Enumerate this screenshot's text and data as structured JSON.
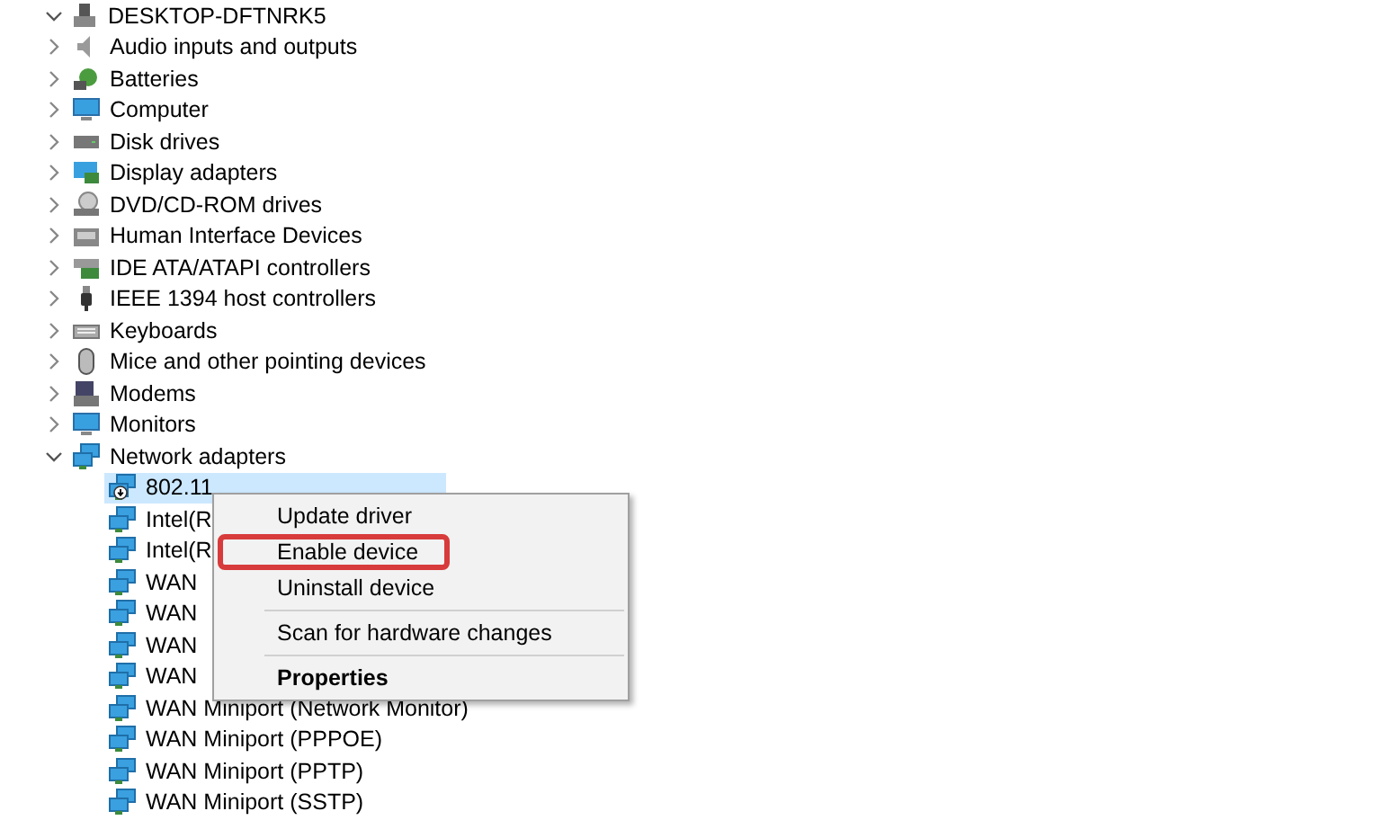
{
  "tree": {
    "label": "DESKTOP-DFTNRK5",
    "expanded": true,
    "children": [
      {
        "label": "Audio inputs and outputs",
        "expanded": false
      },
      {
        "label": "Batteries",
        "expanded": false
      },
      {
        "label": "Computer",
        "expanded": false
      },
      {
        "label": "Disk drives",
        "expanded": false
      },
      {
        "label": "Display adapters",
        "expanded": false
      },
      {
        "label": "DVD/CD-ROM drives",
        "expanded": false
      },
      {
        "label": "Human Interface Devices",
        "expanded": false
      },
      {
        "label": "IDE ATA/ATAPI controllers",
        "expanded": false
      },
      {
        "label": "IEEE 1394 host controllers",
        "expanded": false
      },
      {
        "label": "Keyboards",
        "expanded": false
      },
      {
        "label": "Mice and other pointing devices",
        "expanded": false
      },
      {
        "label": "Modems",
        "expanded": false
      },
      {
        "label": "Monitors",
        "expanded": false
      },
      {
        "label": "Network adapters",
        "expanded": true,
        "children": [
          {
            "label": "802.11",
            "selected": true,
            "disabled": true
          },
          {
            "label": "Intel(R",
            "selected": false,
            "disabled": false
          },
          {
            "label": "Intel(R",
            "selected": false,
            "disabled": false
          },
          {
            "label": "WAN",
            "selected": false,
            "disabled": false
          },
          {
            "label": "WAN",
            "selected": false,
            "disabled": false
          },
          {
            "label": "WAN",
            "selected": false,
            "disabled": false
          },
          {
            "label": "WAN",
            "selected": false,
            "disabled": false
          },
          {
            "label": "WAN Miniport (Network Monitor)",
            "selected": false,
            "disabled": false
          },
          {
            "label": "WAN Miniport (PPPOE)",
            "selected": false,
            "disabled": false
          },
          {
            "label": "WAN Miniport (PPTP)",
            "selected": false,
            "disabled": false
          },
          {
            "label": "WAN Miniport (SSTP)",
            "selected": false,
            "disabled": false
          }
        ]
      }
    ]
  },
  "context_menu": {
    "groups": [
      [
        {
          "label": "Update driver",
          "default": false,
          "highlighted": false
        },
        {
          "label": "Enable device",
          "default": false,
          "highlighted": true
        },
        {
          "label": "Uninstall device",
          "default": false,
          "highlighted": false
        }
      ],
      [
        {
          "label": "Scan for hardware changes",
          "default": false,
          "highlighted": false
        }
      ],
      [
        {
          "label": "Properties",
          "default": true,
          "highlighted": false
        }
      ]
    ]
  }
}
